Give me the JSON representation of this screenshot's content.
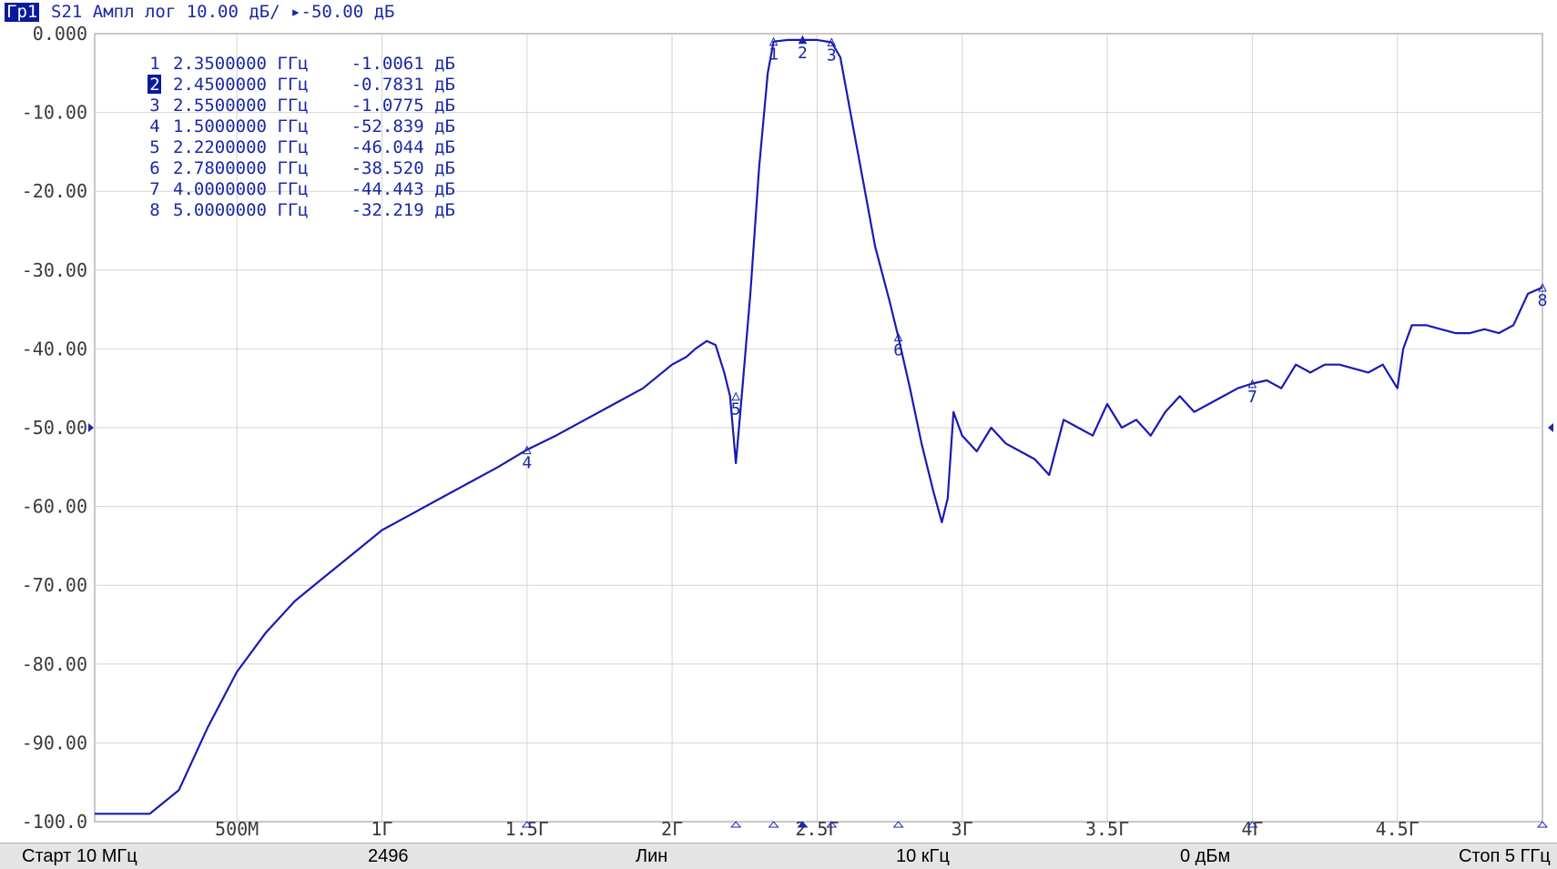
{
  "header": {
    "trace_tag": "Гр1",
    "trace_desc": "S21 Ампл лог 10.00 дБ/ ▸-50.00 дБ"
  },
  "chart_data": {
    "type": "line",
    "title": "",
    "xlabel": "",
    "ylabel": "",
    "xlim": [
      0.01,
      5.0
    ],
    "ylim": [
      -100,
      0
    ],
    "x_unit": "GHz",
    "y_unit": "dB",
    "grid": true,
    "reference_level": -50,
    "y_ticks": [
      "0.000",
      "-10.00",
      "-20.00",
      "-30.00",
      "-40.00",
      "-50.00",
      "-60.00",
      "-70.00",
      "-80.00",
      "-90.00",
      "-100.0"
    ],
    "x_ticks": [
      {
        "value": 0.5,
        "label": "500М"
      },
      {
        "value": 1.0,
        "label": "1Г"
      },
      {
        "value": 1.5,
        "label": "1.5Г"
      },
      {
        "value": 2.0,
        "label": "2Г"
      },
      {
        "value": 2.5,
        "label": "2.5Г"
      },
      {
        "value": 3.0,
        "label": "3Г"
      },
      {
        "value": 3.5,
        "label": "3.5Г"
      },
      {
        "value": 4.0,
        "label": "4Г"
      },
      {
        "value": 4.5,
        "label": "4.5Г"
      }
    ],
    "series": [
      {
        "name": "S21",
        "color": "#1a1ab4",
        "x": [
          0.01,
          0.1,
          0.2,
          0.3,
          0.4,
          0.5,
          0.6,
          0.7,
          0.8,
          0.9,
          1.0,
          1.1,
          1.2,
          1.3,
          1.4,
          1.5,
          1.6,
          1.7,
          1.8,
          1.9,
          2.0,
          2.05,
          2.08,
          2.12,
          2.15,
          2.18,
          2.2,
          2.22,
          2.24,
          2.27,
          2.3,
          2.33,
          2.35,
          2.4,
          2.45,
          2.5,
          2.55,
          2.58,
          2.62,
          2.66,
          2.7,
          2.75,
          2.78,
          2.82,
          2.86,
          2.9,
          2.93,
          2.95,
          2.97,
          3.0,
          3.05,
          3.1,
          3.15,
          3.2,
          3.25,
          3.3,
          3.35,
          3.4,
          3.45,
          3.5,
          3.55,
          3.6,
          3.65,
          3.7,
          3.75,
          3.8,
          3.85,
          3.9,
          3.95,
          4.0,
          4.05,
          4.1,
          4.15,
          4.2,
          4.25,
          4.3,
          4.35,
          4.4,
          4.45,
          4.5,
          4.52,
          4.55,
          4.6,
          4.65,
          4.7,
          4.75,
          4.8,
          4.85,
          4.9,
          4.95,
          5.0
        ],
        "y": [
          -99,
          -99,
          -99,
          -96,
          -88,
          -81,
          -76,
          -72,
          -69,
          -66,
          -63,
          -61,
          -59,
          -57,
          -55,
          -52.8,
          -51,
          -49,
          -47,
          -45,
          -42,
          -41,
          -40,
          -39,
          -39.5,
          -43,
          -46,
          -54.5,
          -46,
          -33,
          -17,
          -5,
          -1.0,
          -0.8,
          -0.8,
          -0.8,
          -1.1,
          -3,
          -11,
          -19,
          -27,
          -34,
          -38.5,
          -45,
          -52,
          -58,
          -62,
          -59,
          -48,
          -51,
          -53,
          -50,
          -52,
          -53,
          -54,
          -56,
          -49,
          -50,
          -51,
          -47,
          -50,
          -49,
          -51,
          -48,
          -46,
          -48,
          -47,
          -46,
          -45,
          -44.4,
          -44,
          -45,
          -42,
          -43,
          -42,
          -42,
          -42.5,
          -43,
          -42,
          -45,
          -40,
          -37,
          -37,
          -37.5,
          -38,
          -38,
          -37.5,
          -38,
          -37,
          -33,
          -32.2
        ]
      }
    ],
    "markers": [
      {
        "num": "1",
        "freq": "2.3500000 ГГц",
        "value": "-1.0061 дБ",
        "x": 2.35,
        "y": -1.0061,
        "active": false
      },
      {
        "num": "2",
        "freq": "2.4500000 ГГц",
        "value": "-0.7831 дБ",
        "x": 2.45,
        "y": -0.7831,
        "active": true
      },
      {
        "num": "3",
        "freq": "2.5500000 ГГц",
        "value": "-1.0775 дБ",
        "x": 2.55,
        "y": -1.0775,
        "active": false
      },
      {
        "num": "4",
        "freq": "1.5000000 ГГц",
        "value": "-52.839 дБ",
        "x": 1.5,
        "y": -52.839,
        "active": false
      },
      {
        "num": "5",
        "freq": "2.2200000 ГГц",
        "value": "-46.044 дБ",
        "x": 2.22,
        "y": -46.044,
        "active": false
      },
      {
        "num": "6",
        "freq": "2.7800000 ГГц",
        "value": "-38.520 дБ",
        "x": 2.78,
        "y": -38.52,
        "active": false
      },
      {
        "num": "7",
        "freq": "4.0000000 ГГц",
        "value": "-44.443 дБ",
        "x": 4.0,
        "y": -44.443,
        "active": false
      },
      {
        "num": "8",
        "freq": "5.0000000 ГГц",
        "value": "-32.219 дБ",
        "x": 5.0,
        "y": -32.219,
        "active": false
      }
    ]
  },
  "footer": {
    "start": "Старт 10 МГц",
    "points": "2496",
    "sweep_type": "Лин",
    "if_bw": "10 кГц",
    "power": "0 дБм",
    "stop": "Стоп 5 ГГц"
  }
}
